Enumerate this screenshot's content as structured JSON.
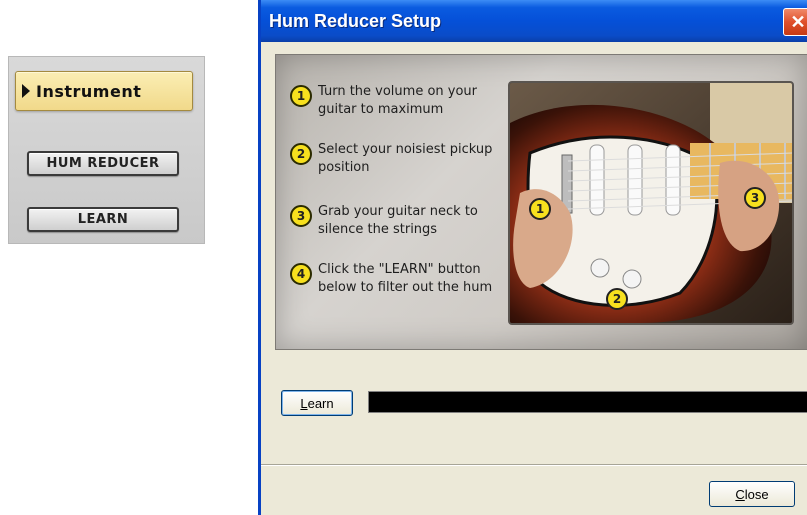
{
  "plugin_panel": {
    "instrument_tab_label": "Instrument",
    "hum_reducer_button": "HUM REDUCER",
    "learn_button": "LEARN"
  },
  "dialog": {
    "title": "Hum Reducer Setup",
    "close_x_glyph": "✕",
    "steps": [
      {
        "number": "1",
        "text": "Turn the volume on your guitar to maximum"
      },
      {
        "number": "2",
        "text": "Select your noisiest pickup position"
      },
      {
        "number": "3",
        "text": "Grab your guitar neck to silence the strings"
      },
      {
        "number": "4",
        "text": "Click the \"LEARN\" button below to filter out the hum"
      }
    ],
    "photo_markers": [
      "1",
      "2",
      "3"
    ],
    "learn_button": {
      "accel": "L",
      "rest": "earn"
    },
    "progress": 0,
    "close_button": {
      "accel": "C",
      "rest": "lose"
    }
  },
  "colors": {
    "titlebar": "#0550d8",
    "dialog_bg": "#ece9d8",
    "marker_yellow": "#f7e01e",
    "instrument_tab": "#f1d98a"
  },
  "icons": {
    "tab_arrow": "play-triangle-icon",
    "close": "close-icon"
  }
}
